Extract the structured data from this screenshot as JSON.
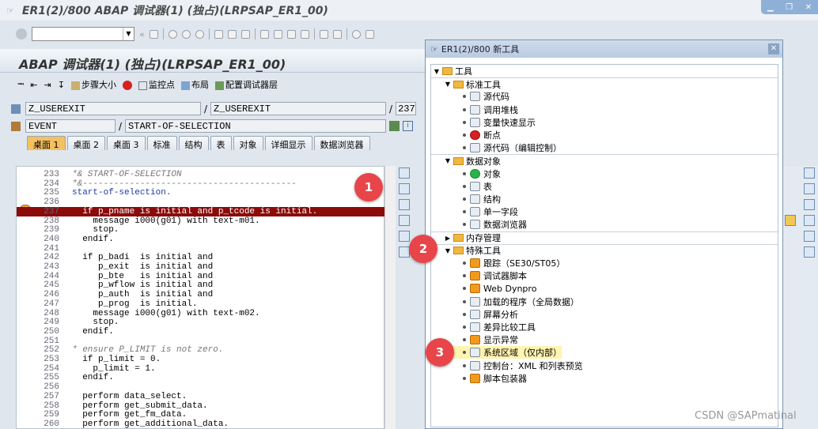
{
  "window": {
    "title": "ER1(2)/800 ABAP 调试器(1) (独占)(LRPSAP_ER1_00)"
  },
  "app": {
    "title": "ABAP 调试器(1) (独占)(LRPSAP_ER1_00)"
  },
  "debug_toolbar": {
    "step_size": "步骤大小",
    "watchpoint": "监控点",
    "layout": "布局",
    "configure": "配置调试器层"
  },
  "fields": {
    "program": "Z_USEREXIT",
    "include": "Z_USEREXIT",
    "line": "237",
    "event_type": "EVENT",
    "event_name": "START-OF-SELECTION"
  },
  "tabs": [
    "桌面 1",
    "桌面 2",
    "桌面 3",
    "标准",
    "结构",
    "表",
    "对象",
    "详细显示",
    "数据浏览器"
  ],
  "code_lines": [
    {
      "n": "233",
      "t": "*& START-OF-SELECTION",
      "c": "cm"
    },
    {
      "n": "234",
      "t": "*&-----------------------------------------",
      "c": "cm"
    },
    {
      "n": "235",
      "t": "start-of-selection.",
      "c": "kw"
    },
    {
      "n": "236",
      "t": "",
      "c": ""
    },
    {
      "n": "237",
      "t": "  if p_pname is initial and p_tcode is initial.",
      "c": "hl"
    },
    {
      "n": "238",
      "t": "    message i000(g01) with text-m01.",
      "c": ""
    },
    {
      "n": "239",
      "t": "    stop.",
      "c": ""
    },
    {
      "n": "240",
      "t": "  endif.",
      "c": ""
    },
    {
      "n": "241",
      "t": "",
      "c": ""
    },
    {
      "n": "242",
      "t": "  if p_badi  is initial and",
      "c": ""
    },
    {
      "n": "243",
      "t": "     p_exit  is initial and",
      "c": ""
    },
    {
      "n": "244",
      "t": "     p_bte   is initial and",
      "c": ""
    },
    {
      "n": "245",
      "t": "     p_wflow is initial and",
      "c": ""
    },
    {
      "n": "246",
      "t": "     p_auth  is initial and",
      "c": ""
    },
    {
      "n": "247",
      "t": "     p_prog  is initial.",
      "c": ""
    },
    {
      "n": "248",
      "t": "    message i000(g01) with text-m02.",
      "c": ""
    },
    {
      "n": "249",
      "t": "    stop.",
      "c": ""
    },
    {
      "n": "250",
      "t": "  endif.",
      "c": ""
    },
    {
      "n": "251",
      "t": "",
      "c": ""
    },
    {
      "n": "252",
      "t": "* ensure P_LIMIT is not zero.",
      "c": "cm"
    },
    {
      "n": "253",
      "t": "  if p_limit = 0.",
      "c": ""
    },
    {
      "n": "254",
      "t": "    p_limit = 1.",
      "c": ""
    },
    {
      "n": "255",
      "t": "  endif.",
      "c": ""
    },
    {
      "n": "256",
      "t": "",
      "c": ""
    },
    {
      "n": "257",
      "t": "  perform data_select.",
      "c": ""
    },
    {
      "n": "258",
      "t": "  perform get_submit_data.",
      "c": ""
    },
    {
      "n": "259",
      "t": "  perform get_fm_data.",
      "c": ""
    },
    {
      "n": "260",
      "t": "  perform get_additional_data.",
      "c": ""
    }
  ],
  "popup": {
    "title": "ER1(2)/800 新工具",
    "root": "工具",
    "standard": {
      "label": "标准工具",
      "items": [
        "源代码",
        "调用堆栈",
        "变量快速显示",
        "断点",
        "源代码（编辑控制）"
      ]
    },
    "data_objects": {
      "label": "数据对象",
      "items": [
        "对象",
        "表",
        "结构",
        "单一字段",
        "数据浏览器"
      ]
    },
    "memory": {
      "label": "内存管理"
    },
    "special": {
      "label": "特殊工具",
      "items": [
        "跟踪（SE30/ST05）",
        "调试器脚本",
        "Web Dynpro",
        "加载的程序（全局数据）",
        "屏幕分析",
        "差异比较工具",
        "显示异常",
        "系统区域（仅内部）",
        "控制台：XML 和列表预览",
        "脚本包装器"
      ]
    }
  },
  "badges": [
    "1",
    "2",
    "3"
  ],
  "watermark": "CSDN @SAPmatinal",
  "colors": {
    "highlight_line": "#8b0b0b",
    "active_tab": "#f4c060",
    "badge": "#e8454a"
  }
}
